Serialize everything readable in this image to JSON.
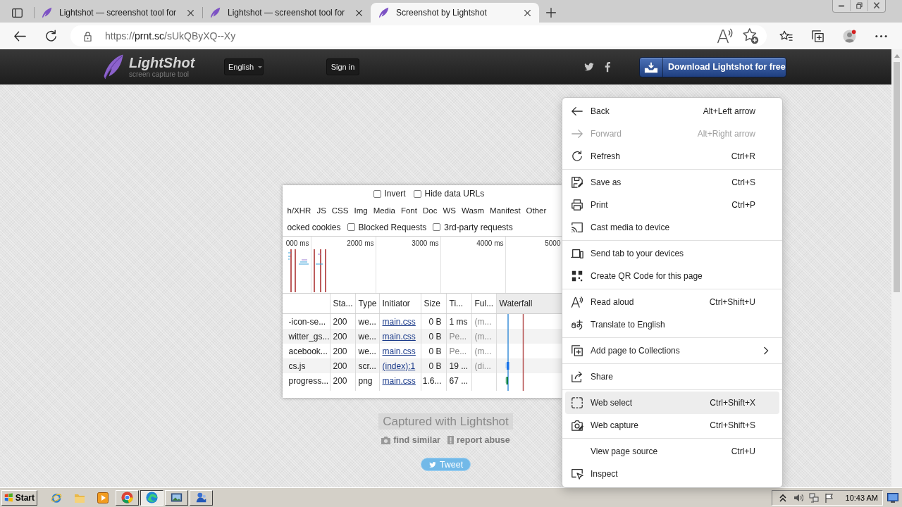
{
  "browser": {
    "tabs": [
      {
        "title": "Lightshot — screenshot tool for",
        "selected": false
      },
      {
        "title": "Lightshot — screenshot tool for",
        "selected": false
      },
      {
        "title": "Screenshot by Lightshot",
        "selected": true
      }
    ],
    "address": {
      "scheme": "https://",
      "host": "prnt.sc",
      "path": "/sUkQByXQ--Xy"
    }
  },
  "site_header": {
    "logo_title": "LightShot",
    "logo_tagline": "screen capture tool",
    "language": "English",
    "sign_in": "Sign in",
    "download_button": "Download Lightshot for free"
  },
  "screenshot": {
    "options": [
      {
        "label": "Invert",
        "checked": false
      },
      {
        "label": "Hide data URLs",
        "checked": false
      }
    ],
    "filters": [
      "h/XHR",
      "JS",
      "CSS",
      "Img",
      "Media",
      "Font",
      "Doc",
      "WS",
      "Wasm",
      "Manifest",
      "Other"
    ],
    "cookies_label": "ocked cookies",
    "request_options": [
      {
        "label": "Blocked Requests",
        "checked": false
      },
      {
        "label": "3rd-party requests",
        "checked": false
      }
    ],
    "timeline_labels": [
      "000 ms",
      "2000 ms",
      "3000 ms",
      "4000 ms",
      "5000"
    ],
    "table": {
      "columns": [
        "Sta...",
        "Type",
        "Initiator",
        "Size",
        "Ti...",
        "Ful...",
        "Waterfall"
      ],
      "rows": [
        {
          "name": "-icon-se...",
          "status": "200",
          "type": "we...",
          "initiator": "main.css",
          "size": "0 B",
          "time": "1 ms",
          "time_pending": false,
          "full": "(m..."
        },
        {
          "name": "witter_gs...",
          "status": "200",
          "type": "we...",
          "initiator": "main.css",
          "size": "0 B",
          "time": "Pe...",
          "time_pending": true,
          "full": "(m..."
        },
        {
          "name": "acebook...",
          "status": "200",
          "type": "we...",
          "initiator": "main.css",
          "size": "0 B",
          "time": "Pe...",
          "time_pending": true,
          "full": "(m..."
        },
        {
          "name": "cs.js",
          "status": "200",
          "type": "scr...",
          "initiator": "(index):1",
          "size": "0 B",
          "time": "19 ...",
          "time_pending": false,
          "full": "(di..."
        },
        {
          "name": "progress...",
          "status": "200",
          "type": "png",
          "initiator": "main.css",
          "size": "1.6...",
          "time": "67 ...",
          "time_pending": false
        }
      ]
    }
  },
  "caption": "Captured with Lightshot",
  "links": [
    "find similar",
    "report abuse"
  ],
  "tweet_button": "Tweet",
  "context_menu": {
    "groups": [
      {
        "items": [
          {
            "label": "Back",
            "shortcut": "Alt+Left arrow",
            "disabled": false,
            "hovered": false,
            "submenu": false
          },
          {
            "label": "Forward",
            "shortcut": "Alt+Right arrow",
            "disabled": true,
            "hovered": false,
            "submenu": false
          },
          {
            "label": "Refresh",
            "shortcut": "Ctrl+R",
            "disabled": false,
            "hovered": false,
            "submenu": false
          }
        ]
      },
      {
        "items": [
          {
            "label": "Save as",
            "shortcut": "Ctrl+S",
            "disabled": false,
            "hovered": false,
            "submenu": false
          },
          {
            "label": "Print",
            "shortcut": "Ctrl+P",
            "disabled": false,
            "hovered": false,
            "submenu": false
          },
          {
            "label": "Cast media to device",
            "disabled": false,
            "hovered": false,
            "submenu": false
          }
        ]
      },
      {
        "items": [
          {
            "label": "Send tab to your devices",
            "disabled": false,
            "hovered": false,
            "submenu": false
          },
          {
            "label": "Create QR Code for this page",
            "disabled": false,
            "hovered": false,
            "submenu": false
          }
        ]
      },
      {
        "items": [
          {
            "label": "Read aloud",
            "shortcut": "Ctrl+Shift+U",
            "disabled": false,
            "hovered": false,
            "submenu": false
          },
          {
            "label": "Translate to English",
            "disabled": false,
            "hovered": false,
            "submenu": false
          }
        ]
      },
      {
        "items": [
          {
            "label": "Add page to Collections",
            "disabled": false,
            "hovered": false,
            "submenu": true
          }
        ]
      },
      {
        "items": [
          {
            "label": "Share",
            "disabled": false,
            "hovered": false,
            "submenu": false
          }
        ]
      },
      {
        "items": [
          {
            "label": "Web select",
            "shortcut": "Ctrl+Shift+X",
            "disabled": false,
            "hovered": true,
            "submenu": false
          },
          {
            "label": "Web capture",
            "shortcut": "Ctrl+Shift+S",
            "disabled": false,
            "hovered": false,
            "submenu": false
          }
        ]
      },
      {
        "items": [
          {
            "label": "View page source",
            "shortcut": "Ctrl+U",
            "disabled": false,
            "hovered": false,
            "submenu": false
          },
          {
            "label": "Inspect",
            "disabled": false,
            "hovered": false,
            "submenu": false
          }
        ]
      }
    ]
  },
  "taskbar": {
    "start": "Start",
    "apps": [
      {
        "selected": false
      },
      {
        "selected": true
      },
      {
        "selected": false
      },
      {
        "selected": false
      }
    ],
    "clock": "10:43 AM"
  }
}
